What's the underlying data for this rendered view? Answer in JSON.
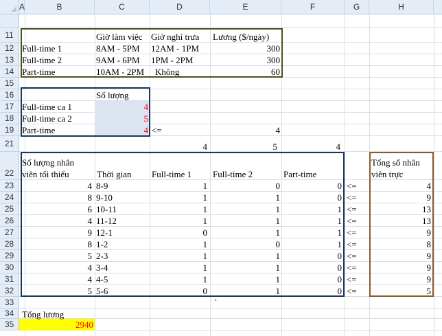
{
  "columns": [
    "A",
    "B",
    "C",
    "D",
    "E",
    "F",
    "G",
    "H"
  ],
  "rows": [
    "11",
    "12",
    "13",
    "14",
    "15",
    "16",
    "17",
    "18",
    "19",
    "21",
    "22",
    "23",
    "24",
    "25",
    "26",
    "27",
    "28",
    "29",
    "30",
    "31",
    "32",
    "33",
    "34",
    "35"
  ],
  "schedule": {
    "headers": [
      "Giờ làm việc",
      "Giờ nghỉ trưa",
      "Lương ($/ngày)"
    ],
    "items": [
      {
        "name": "Full-time 1",
        "work": "8AM - 5PM",
        "lunch": "12AM - 1PM",
        "salary": "300"
      },
      {
        "name": "Full-time 2",
        "work": "9AM - 6PM",
        "lunch": "1PM - 2PM",
        "salary": "300"
      },
      {
        "name": "Part-time",
        "work": "10AM - 2PM",
        "lunch": "Không",
        "salary": "60"
      }
    ]
  },
  "quantity": {
    "header": "Số lượng",
    "items": [
      {
        "name": "Full-time ca 1",
        "value": "4"
      },
      {
        "name": "Full-time ca 2",
        "value": "5"
      },
      {
        "name": "Part-time",
        "value": "4"
      }
    ],
    "constraint_op": "<=",
    "constraint_value": "4"
  },
  "row21": {
    "d": "4",
    "e": "5",
    "f": "4"
  },
  "staffing": {
    "title_line1": "Số lượng nhân",
    "title_line2": "viên tối thiểu",
    "headers": [
      "Thời gian",
      "Full-time 1",
      "Full-time 2",
      "Part-time"
    ],
    "op": "<=",
    "rows": [
      {
        "min": "4",
        "time": "8-9",
        "ft1": "1",
        "ft2": "0",
        "pt": "0",
        "total": "4"
      },
      {
        "min": "8",
        "time": "9-10",
        "ft1": "1",
        "ft2": "1",
        "pt": "0",
        "total": "9"
      },
      {
        "min": "6",
        "time": "10-11",
        "ft1": "1",
        "ft2": "1",
        "pt": "1",
        "total": "13"
      },
      {
        "min": "4",
        "time": "11-12",
        "ft1": "1",
        "ft2": "1",
        "pt": "1",
        "total": "13"
      },
      {
        "min": "9",
        "time": "12-1",
        "ft1": "0",
        "ft2": "1",
        "pt": "1",
        "total": "9"
      },
      {
        "min": "8",
        "time": "1-2",
        "ft1": "1",
        "ft2": "0",
        "pt": "1",
        "total": "8"
      },
      {
        "min": "5",
        "time": "2-3",
        "ft1": "1",
        "ft2": "1",
        "pt": "0",
        "total": "9"
      },
      {
        "min": "4",
        "time": "3-4",
        "ft1": "1",
        "ft2": "1",
        "pt": "0",
        "total": "9"
      },
      {
        "min": "4",
        "time": "4-5",
        "ft1": "1",
        "ft2": "1",
        "pt": "0",
        "total": "9"
      },
      {
        "min": "5",
        "time": "5-6",
        "ft1": "0",
        "ft2": "1",
        "pt": "0",
        "total": "5"
      }
    ]
  },
  "total_staff": {
    "line1": "Tổng số nhân",
    "line2": "viên trực"
  },
  "stray_mark": "`",
  "salary_total": {
    "label": "Tổng lương",
    "value": "2940"
  },
  "colors": {
    "box_olive": "#4f4f1f",
    "box_navy": "#17375e",
    "box_brown": "#8b5a2b",
    "red": "#ff0000",
    "yellow": "#ffff00",
    "fill_blue": "#dbe4f0"
  }
}
